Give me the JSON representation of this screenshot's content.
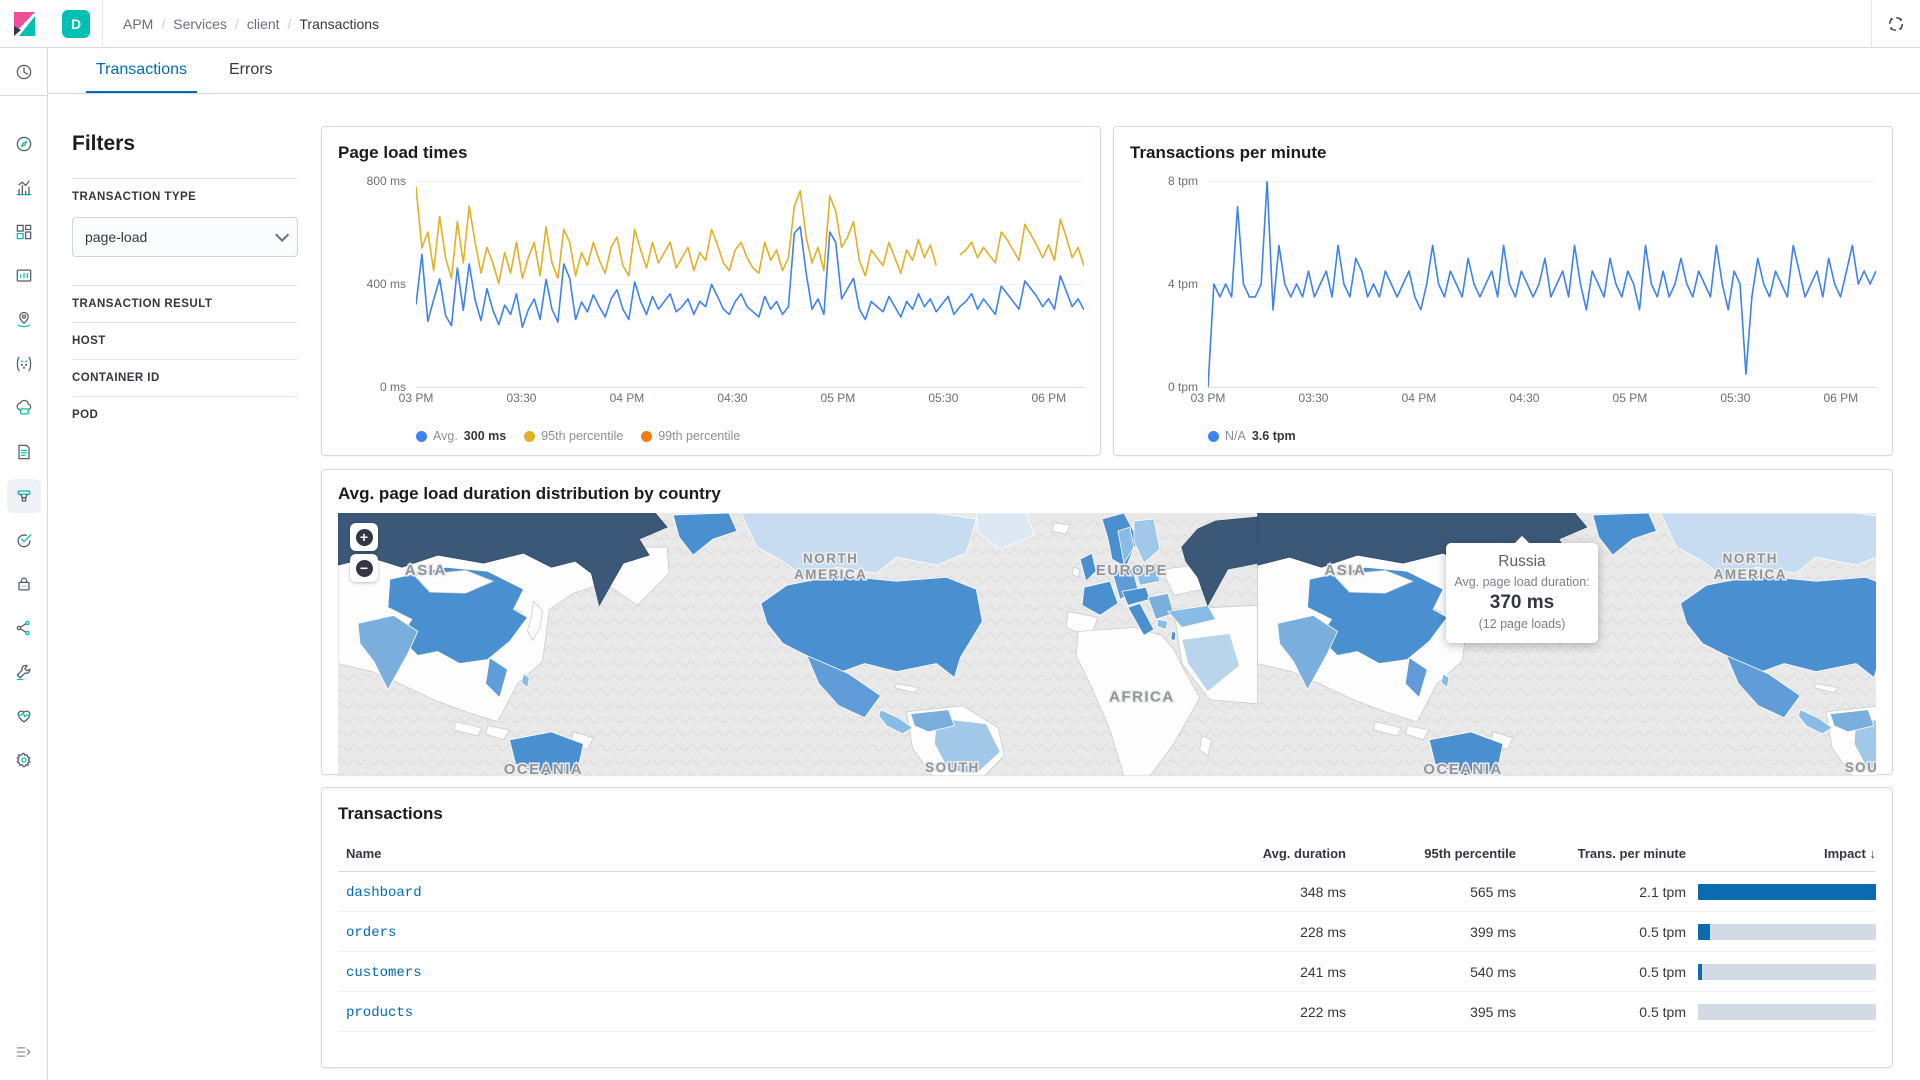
{
  "colors": {
    "accent": "#006bb4",
    "badge_teal": "#00bfb3",
    "chart_blue": "#3e82f0",
    "chart_yellow": "#e2b025",
    "chart_orange": "#f07d12",
    "impact_fill": "#0a6cad",
    "impact_track": "#d3dae6",
    "map_dark": "#3b5878",
    "map_mid": "#4a90d1",
    "map_light": "#7aaedd",
    "map_pale": "#b8d5ec"
  },
  "header": {
    "space_badge": "D",
    "breadcrumb": [
      "APM",
      "Services",
      "client",
      "Transactions"
    ]
  },
  "sidebar": {
    "items": [
      "recently-viewed",
      "discover",
      "visualize",
      "dashboard",
      "canvas",
      "maps",
      "machine-learning",
      "infrastructure",
      "logs",
      "apm",
      "uptime",
      "siem",
      "graph",
      "dev-tools",
      "stack-monitoring",
      "management",
      "collapse-navigation"
    ],
    "selected": "apm"
  },
  "tabs": [
    {
      "label": "Transactions",
      "active": true
    },
    {
      "label": "Errors",
      "active": false
    }
  ],
  "filters": {
    "title": "Filters",
    "sections": [
      {
        "label": "TRANSACTION TYPE",
        "control": "select",
        "value": "page-load"
      },
      {
        "label": "TRANSACTION RESULT"
      },
      {
        "label": "HOST"
      },
      {
        "label": "CONTAINER ID"
      },
      {
        "label": "POD"
      }
    ]
  },
  "chart_data": [
    {
      "type": "line",
      "title": "Page load times",
      "ylabel": "ms",
      "ylim": [
        0,
        800
      ],
      "yticks": [
        "0 ms",
        "400 ms",
        "800 ms"
      ],
      "x_ticks": [
        "03 PM",
        "03:30",
        "04 PM",
        "04:30",
        "05 PM",
        "05:30",
        "06 PM"
      ],
      "x_tick_minutes": [
        0,
        30,
        60,
        90,
        120,
        150,
        180
      ],
      "x_total_minutes": 190,
      "grid": "horizontal",
      "legend_position": "bottom",
      "series": [
        {
          "name": "Avg.",
          "value_label": "300 ms",
          "color": "#3e82f0",
          "values": [
            320,
            515,
            255,
            340,
            420,
            278,
            238,
            462,
            298,
            478,
            338,
            258,
            382,
            300,
            242,
            318,
            282,
            362,
            232,
            300,
            342,
            262,
            418,
            302,
            252,
            478,
            422,
            262,
            330,
            292,
            358,
            312,
            272,
            342,
            378,
            302,
            262,
            408,
            332,
            282,
            352,
            302,
            332,
            362,
            292,
            312,
            342,
            282,
            332,
            312,
            398,
            352,
            302,
            282,
            332,
            362,
            312,
            292,
            272,
            352,
            302,
            332,
            282,
            312,
            598,
            622,
            442,
            302,
            342,
            282,
            602,
            562,
            342,
            382,
            422,
            302,
            262,
            332,
            312,
            292,
            352,
            312,
            272,
            332,
            302,
            362,
            312,
            342,
            292,
            322,
            352,
            282,
            312,
            332,
            362,
            302,
            342,
            312,
            282,
            392,
            362,
            332,
            302,
            412,
            382,
            352,
            312,
            342,
            302,
            432,
            372,
            312,
            342,
            300
          ]
        },
        {
          "name": "95th percentile",
          "value_label": "",
          "color": "#e2b025",
          "values": [
            778,
            540,
            602,
            452,
            662,
            502,
            422,
            642,
            482,
            702,
            562,
            442,
            542,
            482,
            402,
            522,
            442,
            562,
            422,
            502,
            562,
            432,
            622,
            482,
            422,
            612,
            562,
            432,
            522,
            472,
            562,
            492,
            442,
            542,
            582,
            472,
            432,
            612,
            532,
            462,
            562,
            482,
            522,
            562,
            462,
            502,
            542,
            452,
            522,
            492,
            612,
            552,
            482,
            452,
            532,
            562,
            502,
            462,
            442,
            562,
            492,
            532,
            452,
            502,
            702,
            762,
            582,
            482,
            542,
            452,
            742,
            682,
            542,
            582,
            642,
            492,
            432,
            532,
            502,
            472,
            562,
            502,
            442,
            532,
            492,
            572,
            502,
            552,
            472,
            null,
            null,
            null,
            512,
            532,
            562,
            502,
            542,
            512,
            482,
            602,
            572,
            532,
            492,
            632,
            592,
            552,
            502,
            552,
            492,
            652,
            582,
            502,
            542,
            470
          ]
        },
        {
          "name": "99th percentile",
          "value_label": "",
          "color": "#f07d12",
          "values": []
        }
      ]
    },
    {
      "type": "line",
      "title": "Transactions per minute",
      "ylabel": "tpm",
      "ylim": [
        0,
        8
      ],
      "yticks": [
        "0 tpm",
        "4 tpm",
        "8 tpm"
      ],
      "x_ticks": [
        "03 PM",
        "03:30",
        "04 PM",
        "04:30",
        "05 PM",
        "05:30",
        "06 PM"
      ],
      "x_tick_minutes": [
        0,
        30,
        60,
        90,
        120,
        150,
        180
      ],
      "x_total_minutes": 190,
      "grid": "horizontal",
      "legend_position": "bottom",
      "series": [
        {
          "name": "N/A",
          "value_label": "3.6 tpm",
          "color": "#3e82f0",
          "values": [
            0,
            4,
            3.5,
            4,
            3.5,
            7,
            4,
            3.5,
            3.5,
            4,
            8,
            3,
            5.5,
            4,
            3.5,
            4,
            3.5,
            4.5,
            3.5,
            4,
            4.5,
            3.5,
            5.5,
            4,
            3.5,
            5,
            4.5,
            3.5,
            4,
            3.5,
            4.5,
            4,
            3.5,
            4,
            4.5,
            3.5,
            3,
            4,
            5.5,
            4,
            3.5,
            4.5,
            4,
            3.5,
            5,
            4,
            3.5,
            4,
            4.5,
            3.5,
            5.5,
            4,
            3.5,
            4.5,
            4,
            3.5,
            4,
            5,
            3.5,
            4,
            4.5,
            3.5,
            5.5,
            4,
            3,
            4.5,
            4,
            3.5,
            5,
            4,
            3.5,
            4.5,
            4,
            3,
            5.5,
            4,
            3.5,
            4.5,
            3.5,
            4,
            5,
            4,
            3.5,
            4.5,
            4,
            3.5,
            5.5,
            4,
            3,
            4.5,
            4,
            0.5,
            3.5,
            5,
            4,
            3.5,
            4.5,
            4,
            3.5,
            5.5,
            4.5,
            3.5,
            4,
            4.5,
            3.5,
            5,
            4,
            3.5,
            4.5,
            5.5,
            4,
            4.5,
            4,
            4.5
          ]
        }
      ]
    },
    {
      "type": "heatmap",
      "subtype": "choropleth-world-map",
      "title": "Avg. page load duration distribution by country",
      "tooltip_point": {
        "country": "Russia",
        "metric": "Avg. page load duration:",
        "value": "370 ms",
        "sample": "(12 page loads)"
      },
      "shaded_regions": [
        "Russia (darkest)",
        "China",
        "United States",
        "Australia",
        "United Kingdom",
        "France",
        "Scandinavia",
        "India",
        "Mexico",
        "Turkey",
        "Saudi Arabia (pale)",
        "Canada (pale)",
        "Brazil (pale)"
      ]
    }
  ],
  "map": {
    "title": "Avg. page load duration distribution by country",
    "zoom_in": "+",
    "zoom_out": "−",
    "labels": {
      "asia": "ASIA",
      "north": "NORTH",
      "america": "AMERICA",
      "europe": "EUROPE",
      "africa": "AFRICA",
      "oceania": "OCEANIA",
      "south": "SOUTH"
    },
    "tooltip": {
      "title": "Russia",
      "label": "Avg. page load duration:",
      "value": "370 ms",
      "loads": "(12 page loads)"
    }
  },
  "table": {
    "title": "Transactions",
    "columns": [
      "Name",
      "Avg. duration",
      "95th percentile",
      "Trans. per minute",
      "Impact"
    ],
    "sort_arrow": "↓",
    "rows": [
      {
        "name": "dashboard",
        "avg": "348 ms",
        "p95": "565 ms",
        "tpm": "2.1 tpm",
        "impact_pct": 100
      },
      {
        "name": "orders",
        "avg": "228 ms",
        "p95": "399 ms",
        "tpm": "0.5 tpm",
        "impact_pct": 7
      },
      {
        "name": "customers",
        "avg": "241 ms",
        "p95": "540 ms",
        "tpm": "0.5 tpm",
        "impact_pct": 2
      },
      {
        "name": "products",
        "avg": "222 ms",
        "p95": "395 ms",
        "tpm": "0.5 tpm",
        "impact_pct": 0
      }
    ]
  }
}
